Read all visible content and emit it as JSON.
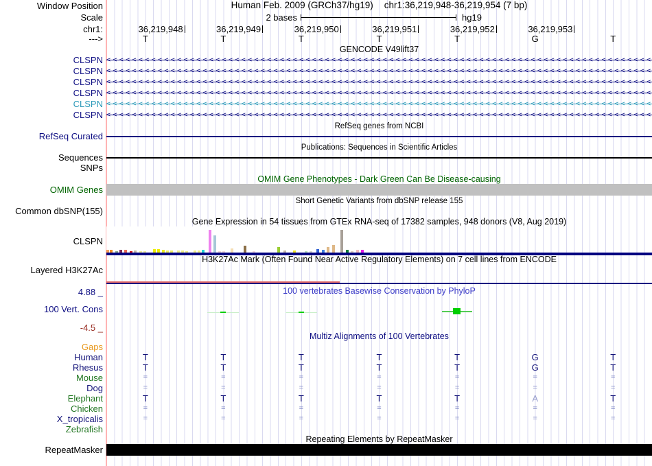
{
  "header": {
    "assembly": "Human Feb. 2009 (GRCh37/hg19)",
    "position": "chr1:36,219,948-36,219,954 (7 bp)",
    "window_position_label": "Window Position",
    "scale_label": "Scale",
    "scale_value": "2 bases",
    "scale_right": "hg19",
    "chrom_label": "chr1:",
    "strand_label": "--->",
    "ruler_ticks": [
      "36,219,948",
      "36,219,949",
      "36,219,950",
      "36,219,951",
      "36,219,952",
      "36,219,953"
    ],
    "sequence": [
      "T",
      "T",
      "T",
      "T",
      "T",
      "G",
      "T"
    ]
  },
  "tracks": {
    "gencode": {
      "title": "GENCODE V49lift37",
      "transcripts": [
        {
          "label": "CLSPN",
          "color": "#0c0c82"
        },
        {
          "label": "CLSPN",
          "color": "#0c0c82"
        },
        {
          "label": "CLSPN",
          "color": "#0c0c82"
        },
        {
          "label": "CLSPN",
          "color": "#0c0c82"
        },
        {
          "label": "CLSPN",
          "color": "#2898b8"
        },
        {
          "label": "CLSPN",
          "color": "#0c0c82"
        }
      ]
    },
    "refseq": {
      "title": "RefSeq genes from NCBI",
      "label": "RefSeq Curated"
    },
    "publications": {
      "title": "Publications: Sequences in Scientific Articles",
      "label": "Sequences",
      "label2": "SNPs"
    },
    "omim": {
      "title": "OMIM Gene Phenotypes - Dark Green Can Be Disease-causing",
      "label": "OMIM Genes"
    },
    "dbsnp": {
      "title": "Short Genetic Variants from dbSNP release 155",
      "label": "Common dbSNP(155)"
    },
    "gtex": {
      "title": "Gene Expression in 54 tissues from GTEx RNA-seq of 17382 samples, 948 donors (V8, Aug 2019)",
      "label": "CLSPN"
    },
    "h3k27ac": {
      "title": "H3K27Ac Mark (Often Found Near Active Regulatory Elements) on 7 cell lines from ENCODE",
      "label": "Layered H3K27Ac"
    },
    "phylop": {
      "title": "100 vertebrates Basewise Conservation by PhyloP",
      "label": "100 Vert. Cons",
      "max_label": "4.88 _",
      "min_label": "-4.5 _"
    },
    "multiz": {
      "title": "Multiz Alignments of 100 Vertebrates",
      "gaps_label": "Gaps",
      "rows": [
        {
          "label": "Gaps",
          "color": "#e8981c",
          "cells": []
        },
        {
          "label": "Human",
          "color": "#14147a",
          "cells": [
            "T",
            "T",
            "T",
            "T",
            "T",
            "G",
            "T"
          ]
        },
        {
          "label": "Rhesus",
          "color": "#14147a",
          "cells": [
            "T",
            "T",
            "T",
            "T",
            "T",
            "G",
            "T"
          ]
        },
        {
          "label": "Mouse",
          "color": "#227722",
          "cells": [
            "=",
            "=",
            "=",
            "=",
            "=",
            "=",
            "="
          ]
        },
        {
          "label": "Dog",
          "color": "#14147a",
          "cells": [
            "=",
            "=",
            "=",
            "=",
            "=",
            "=",
            "="
          ]
        },
        {
          "label": "Elephant",
          "color": "#227722",
          "cells": [
            "T",
            "T",
            "T",
            "T",
            "T",
            "A",
            "T"
          ]
        },
        {
          "label": "Chicken",
          "color": "#227722",
          "cells": [
            "=",
            "=",
            "=",
            "=",
            "=",
            "=",
            "="
          ]
        },
        {
          "label": "X_tropicalis",
          "color": "#14147a",
          "cells": [
            "=",
            "=",
            "=",
            "=",
            "=",
            "=",
            "="
          ]
        },
        {
          "label": "Zebrafish",
          "color": "#227722",
          "cells": []
        }
      ]
    },
    "repeatmasker": {
      "title": "Repeating Elements by RepeatMasker",
      "label": "RepeatMasker"
    }
  },
  "chart_data": [
    {
      "type": "bar",
      "title": "Gene Expression in 54 tissues from GTEx RNA-seq of 17382 samples, 948 donors (V8, Aug 2019)",
      "gene": "CLSPN",
      "ylabel": "expression (bar height px, max 33)",
      "bars": [
        [
          0,
          4,
          "#f4a05a"
        ],
        [
          5,
          4,
          "#ef8b1f"
        ],
        [
          13,
          2,
          "#8fae8f"
        ],
        [
          19,
          4,
          "#7c2a55"
        ],
        [
          26,
          4,
          "#ea6a55"
        ],
        [
          34,
          2,
          "#d01515"
        ],
        [
          40,
          3,
          "#c2b5a5"
        ],
        [
          48,
          2,
          "#efef9a"
        ],
        [
          54,
          2,
          "#efef9a"
        ],
        [
          68,
          5,
          "#eded00"
        ],
        [
          74,
          5,
          "#eded00"
        ],
        [
          81,
          4,
          "#eded22"
        ],
        [
          87,
          3,
          "#efef66"
        ],
        [
          93,
          3,
          "#efef66"
        ],
        [
          103,
          3,
          "#efef88"
        ],
        [
          109,
          3,
          "#efef88"
        ],
        [
          115,
          2,
          "#efef88"
        ],
        [
          127,
          3,
          "#efef88"
        ],
        [
          133,
          3,
          "#efef88"
        ],
        [
          139,
          4,
          "#22d5d5"
        ],
        [
          149,
          33,
          "#ee82ee"
        ],
        [
          156,
          25,
          "#a6c7d7"
        ],
        [
          163,
          2,
          "#f2d9d9"
        ],
        [
          169,
          2,
          "#f2d9d9"
        ],
        [
          181,
          6,
          "#f5deb3"
        ],
        [
          200,
          10,
          "#8b6f47"
        ],
        [
          213,
          2,
          "#f2d9d9"
        ],
        [
          249,
          8,
          "#9acd32"
        ],
        [
          258,
          3,
          "#c2b5a5"
        ],
        [
          272,
          3,
          "#ede21f"
        ],
        [
          289,
          2,
          "#b8e0b8"
        ],
        [
          296,
          2,
          "#d8d8d0"
        ],
        [
          306,
          5,
          "#3060d0"
        ],
        [
          314,
          4,
          "#4080e0"
        ],
        [
          321,
          8,
          "#deb887"
        ],
        [
          329,
          11,
          "#deb887"
        ],
        [
          341,
          33,
          "#a8a098"
        ],
        [
          349,
          4,
          "#0e7a3a"
        ],
        [
          356,
          2,
          "#e0d0c0"
        ],
        [
          364,
          4,
          "#f0bcbc"
        ],
        [
          371,
          4,
          "#e81ce8"
        ]
      ]
    },
    {
      "type": "wiggle",
      "title": "100 vertebrates Basewise Conservation by PhyloP",
      "y_max": 4.88,
      "y_min": -4.5,
      "marks": [
        {
          "base_index": 1,
          "style": "dash"
        },
        {
          "base_index": 2,
          "style": "dash"
        },
        {
          "base_index": 4,
          "style": "block"
        }
      ]
    }
  ],
  "colors": {
    "navy": "#0c0c82",
    "teal": "#2898b8",
    "dark_green": "#006400",
    "phylop_blue": "#3c3cc8",
    "maroon": "#96281e",
    "orange": "#e8981c",
    "grid": "#dadaf0",
    "edge_pink": "#ffb3b3",
    "omim_gray": "#c0c0c0",
    "gtex_line": "#000080",
    "h3k27ac_red": "#e06a6a",
    "refseq_line": "#000080",
    "letter": "#14147a",
    "muted": "#7b84c4",
    "mismatch": "#9aa0ce",
    "green_mark": "#00ce00",
    "green_mark_faint": "#c8eec8",
    "green_mark_mid": "#55cc55",
    "repeat_black": "#000000"
  }
}
